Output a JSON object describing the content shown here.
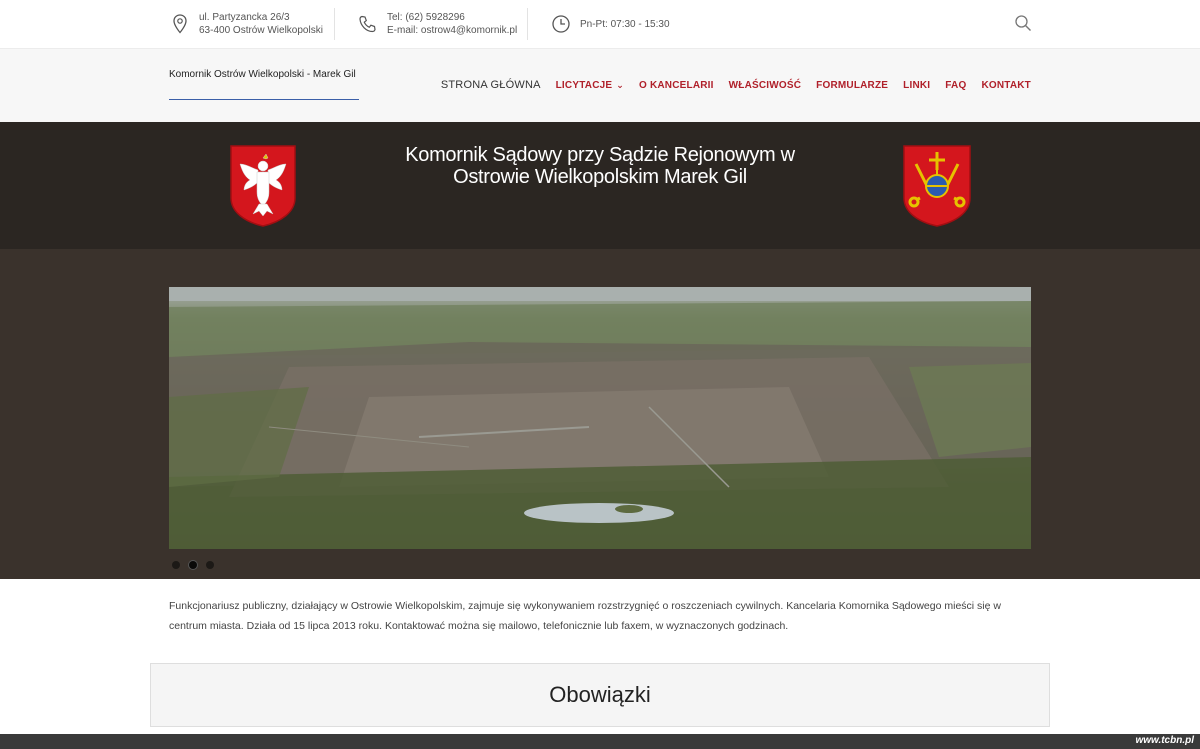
{
  "topbar": {
    "address_line1": "ul. Partyzancka 26/3",
    "address_line2": "63-400 Ostrów Wielkopolski",
    "phone": "Tel: (62) 5928296",
    "email": "E-mail: ostrow4@komornik.pl",
    "hours": "Pn-Pt: 07:30 - 15:30",
    "icons": [
      "location-pin-icon",
      "phone-icon",
      "clock-icon",
      "search-icon"
    ]
  },
  "nav": {
    "brand": "Komornik Ostrów Wielkopolski - Marek Gil",
    "items": [
      {
        "label": "STRONA GŁÓWNA"
      },
      {
        "label": "LICYTACJE"
      },
      {
        "label": "O KANCELARII"
      },
      {
        "label": "WŁAŚCIWOŚĆ"
      },
      {
        "label": "FORMULARZE"
      },
      {
        "label": "LINKI"
      },
      {
        "label": "FAQ"
      },
      {
        "label": "KONTAKT"
      }
    ],
    "accent_color": "#b0202a"
  },
  "banner": {
    "title": "Komornik Sądowy przy Sądzie Rejonowym w Ostrowie Wielkopolskim Marek Gil"
  },
  "slider": {
    "slide_count": 3,
    "active_index": 1
  },
  "intro": {
    "text": "Funkcjonariusz publiczny, działający w Ostrowie Wielkopolskim, zajmuje się wykonywaniem rozstrzygnięć o roszczeniach cywilnych. Kancelaria Komornika Sądowego mieści się w centrum miasta. Działa od 15 lipca 2013 roku. Kontaktować można się mailowo, telefonicznie lub faxem, w wyznaczonych godzinach."
  },
  "section": {
    "title": "Obowiązki"
  },
  "footer": {
    "watermark": "www.tcbn.pl"
  }
}
